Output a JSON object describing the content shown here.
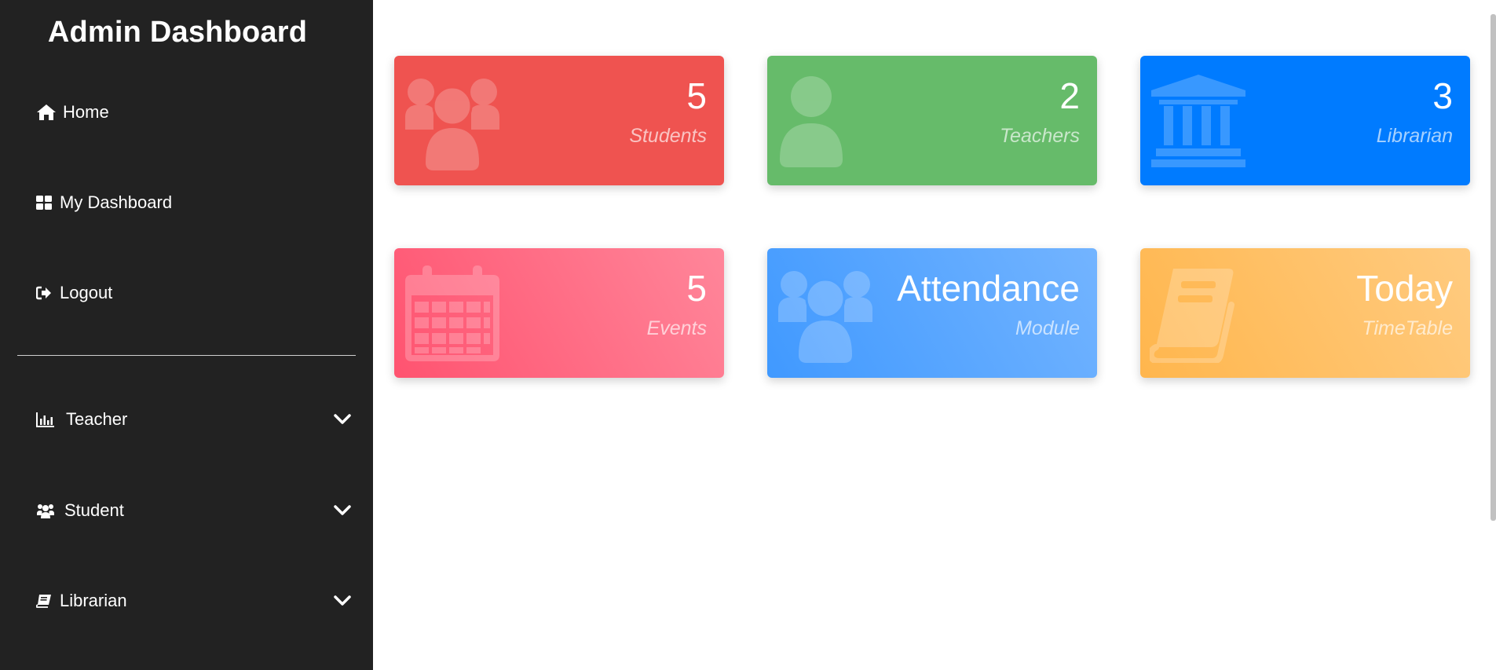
{
  "sidebar": {
    "title": "Admin Dashboard",
    "items": [
      {
        "label": "Home",
        "icon": "home-icon"
      },
      {
        "label": "My Dashboard",
        "icon": "dashboard-icon"
      },
      {
        "label": "Logout",
        "icon": "logout-icon"
      },
      {
        "label": "Teacher",
        "icon": "bar-chart-icon"
      },
      {
        "label": "Student",
        "icon": "users-icon"
      },
      {
        "label": "Librarian",
        "icon": "book-icon"
      }
    ]
  },
  "cards": [
    {
      "value": "5",
      "label": "Students",
      "color": "#ef5350",
      "icon": "users-icon"
    },
    {
      "value": "2",
      "label": "Teachers",
      "color": "#66bb6a",
      "icon": "user-icon"
    },
    {
      "value": "3",
      "label": "Librarian",
      "color": "#007bff",
      "icon": "institution-icon"
    },
    {
      "value": "5",
      "label": "Events",
      "color": "#ff5370",
      "icon": "calendar-icon"
    },
    {
      "value": "Attendance",
      "label": "Module",
      "color": "#4099ff",
      "icon": "users-icon"
    },
    {
      "value": "Today",
      "label": "TimeTable",
      "color": "#ffb64d",
      "icon": "book-icon"
    }
  ]
}
